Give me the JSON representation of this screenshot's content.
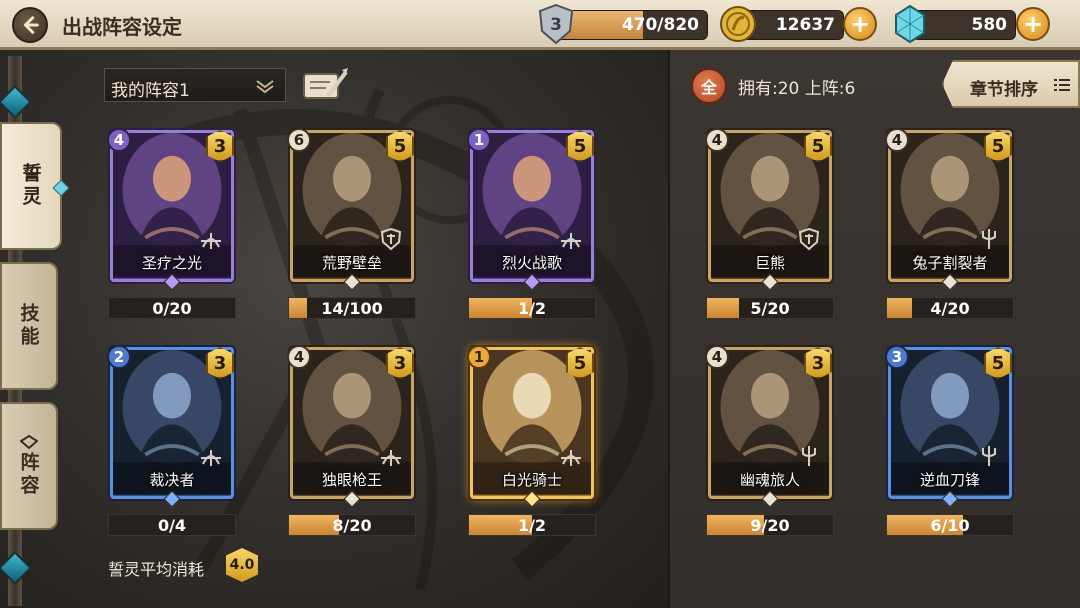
{
  "header": {
    "title": "出战阵容设定",
    "stamina": {
      "badge": "3",
      "value": "470/820",
      "fill": 0.573
    },
    "gold": {
      "value": "12637"
    },
    "gems": {
      "value": "580"
    }
  },
  "side_tabs": [
    {
      "label": "誓灵",
      "active": true
    },
    {
      "label": "技能",
      "active": false
    },
    {
      "label": "阵容",
      "active": false
    }
  ],
  "lineup": {
    "name": "我的阵容1",
    "average_cost_label": "誓灵平均消耗",
    "average_cost": "4.0",
    "cards": [
      {
        "name": "圣疗之光",
        "count": "4",
        "cost": "3",
        "rarity": "purple",
        "progress": "0/20",
        "fill": 0.0,
        "icon": "bow-class-icon"
      },
      {
        "name": "荒野壁垒",
        "count": "6",
        "cost": "5",
        "rarity": "bronze",
        "progress": "14/100",
        "fill": 0.14,
        "icon": "shield-class-icon"
      },
      {
        "name": "烈火战歌",
        "count": "1",
        "cost": "5",
        "rarity": "purple",
        "progress": "1/2",
        "fill": 0.5,
        "icon": "bow-class-icon"
      },
      {
        "name": "裁决者",
        "count": "2",
        "cost": "3",
        "rarity": "blue",
        "progress": "0/4",
        "fill": 0.0,
        "icon": "bow-class-icon"
      },
      {
        "name": "独眼枪王",
        "count": "4",
        "cost": "3",
        "rarity": "bronze",
        "progress": "8/20",
        "fill": 0.4,
        "icon": "bow-class-icon"
      },
      {
        "name": "白光骑士",
        "count": "1",
        "cost": "5",
        "rarity": "gold",
        "progress": "1/2",
        "fill": 0.5,
        "icon": "bow-class-icon"
      }
    ]
  },
  "collection": {
    "all_label": "全",
    "owned_text": "拥有:20  上阵:6",
    "sort_label": "章节排序",
    "cards": [
      {
        "name": "巨熊",
        "count": "4",
        "cost": "5",
        "rarity": "bronze",
        "progress": "5/20",
        "fill": 0.25,
        "icon": "shield-class-icon"
      },
      {
        "name": "兔子割裂者",
        "count": "4",
        "cost": "5",
        "rarity": "bronze",
        "progress": "4/20",
        "fill": 0.2,
        "icon": "trident-class-icon"
      },
      {
        "name": "幽魂旅人",
        "count": "4",
        "cost": "3",
        "rarity": "bronze",
        "progress": "9/20",
        "fill": 0.45,
        "icon": "trident-class-icon"
      },
      {
        "name": "逆血刀锋",
        "count": "3",
        "cost": "5",
        "rarity": "blue",
        "progress": "6/10",
        "fill": 0.6,
        "icon": "trident-class-icon"
      }
    ]
  },
  "colors": {
    "accent_orange": "#e8a83a",
    "purple_rarity": "#9b7fd6",
    "blue_rarity": "#5e8ee0",
    "gold_rarity": "#f2c35c"
  }
}
